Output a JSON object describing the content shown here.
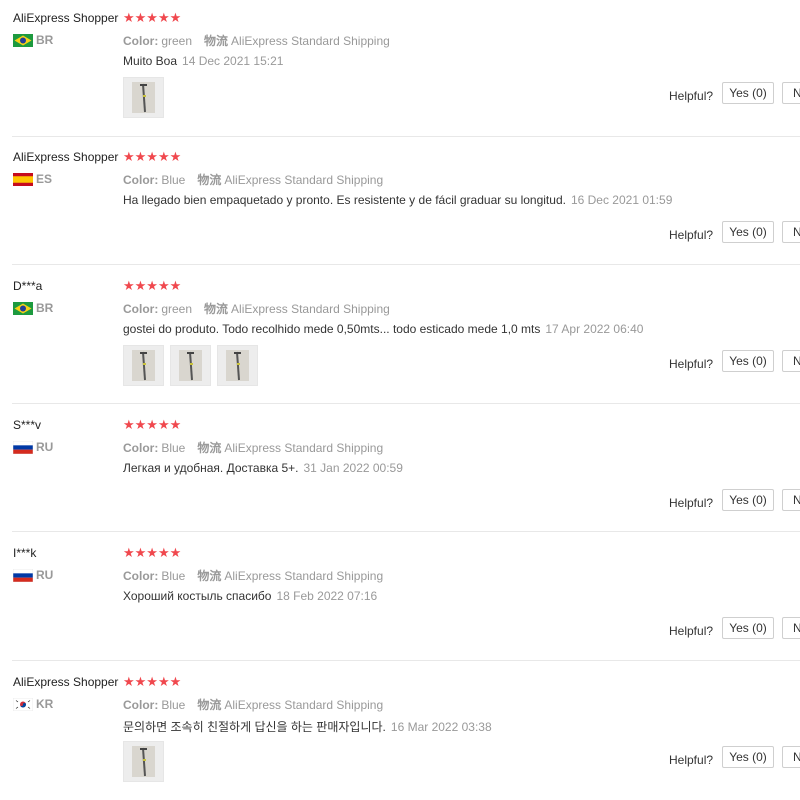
{
  "labels": {
    "color_key": "Color:",
    "ship_key": "物流",
    "helpful": "Helpful?",
    "stars": "★★★★★"
  },
  "reviews": [
    {
      "user": "AliExpress Shopper",
      "country": "BR",
      "flag": "br",
      "color": "green",
      "shipping": "AliExpress Standard Shipping",
      "text": "Muito Boa",
      "date": "14 Dec 2021 15:21",
      "rating": 5,
      "photos": [
        "crutch-photo"
      ],
      "yes_label": "Yes (0)",
      "no_label": "N"
    },
    {
      "user": "AliExpress Shopper",
      "country": "ES",
      "flag": "es",
      "color": "Blue",
      "shipping": "AliExpress Standard Shipping",
      "text": "Ha llegado bien empaquetado y pronto. Es resistente y de fácil graduar su longitud.",
      "date": "16 Dec 2021 01:59",
      "rating": 5,
      "photos": [],
      "yes_label": "Yes (0)",
      "no_label": "N"
    },
    {
      "user": "D***a",
      "country": "BR",
      "flag": "br",
      "color": "green",
      "shipping": "AliExpress Standard Shipping",
      "text": "gostei do produto. Todo recolhido mede 0,50mts... todo esticado mede 1,0 mts",
      "date": "17 Apr 2022 06:40",
      "rating": 5,
      "photos": [
        "crutch-photo",
        "crutch-photo",
        "crutch-photo"
      ],
      "yes_label": "Yes (0)",
      "no_label": "N"
    },
    {
      "user": "S***v",
      "country": "RU",
      "flag": "ru",
      "color": "Blue",
      "shipping": "AliExpress Standard Shipping",
      "text": "Легкая и удобная. Доставка 5+.",
      "date": "31 Jan 2022 00:59",
      "rating": 5,
      "photos": [],
      "yes_label": "Yes (0)",
      "no_label": "N"
    },
    {
      "user": "I***k",
      "country": "RU",
      "flag": "ru",
      "color": "Blue",
      "shipping": "AliExpress Standard Shipping",
      "text": "Хороший костыль спасибо",
      "date": "18 Feb 2022 07:16",
      "rating": 5,
      "photos": [],
      "yes_label": "Yes (0)",
      "no_label": "N"
    },
    {
      "user": "AliExpress Shopper",
      "country": "KR",
      "flag": "kr",
      "color": "Blue",
      "shipping": "AliExpress Standard Shipping",
      "text": "문의하면 조속히 친절하게 답신을 하는 판매자입니다.",
      "date": "16 Mar 2022 03:38",
      "rating": 5,
      "photos": [
        "crutch-photo"
      ],
      "yes_label": "Yes (0)",
      "no_label": "N"
    }
  ],
  "colors": {
    "star": "#f0484e",
    "muted": "#999999",
    "divider": "#e8e8e8"
  }
}
